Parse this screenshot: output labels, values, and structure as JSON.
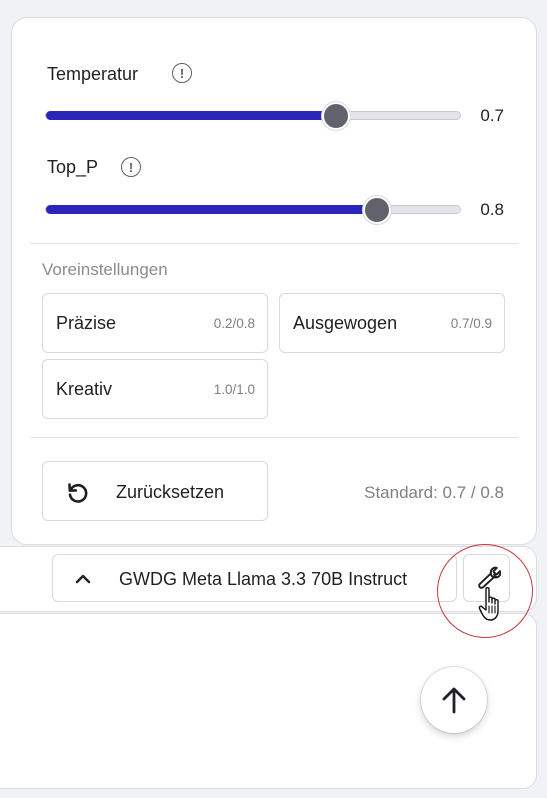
{
  "settings": {
    "temperature": {
      "label": "Temperatur",
      "value": "0.7",
      "fraction": 0.7
    },
    "top_p": {
      "label": "Top_P",
      "value": "0.8",
      "fraction": 0.8
    },
    "presets_heading": "Voreinstellungen",
    "presets": [
      {
        "name": "Präzise",
        "values": "0.2/0.8"
      },
      {
        "name": "Ausgewogen",
        "values": "0.7/0.9"
      },
      {
        "name": "Kreativ",
        "values": "1.0/1.0"
      }
    ],
    "reset_label": "Zurücksetzen",
    "standard_text": "Standard: 0.7 / 0.8"
  },
  "toolbar": {
    "model_name": "GWDG Meta Llama 3.3 70B Instruct"
  },
  "icons": {
    "info": "info-icon",
    "reset": "reset-icon",
    "chevron": "chevron-up-icon",
    "tools": "wrench-icon",
    "send": "arrow-up-icon",
    "cursor": "hand-pointer-icon"
  },
  "colors": {
    "slider_fill": "#2b25b9",
    "slider_thumb": "#62626d",
    "highlight_ring": "#c0393b"
  }
}
